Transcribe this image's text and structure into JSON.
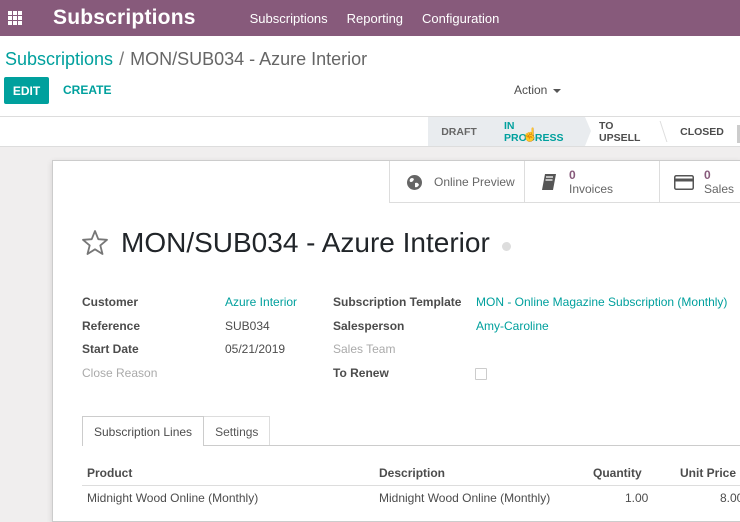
{
  "navbar": {
    "brand": "Subscriptions",
    "menu": [
      "Subscriptions",
      "Reporting",
      "Configuration"
    ]
  },
  "breadcrumb": {
    "parent": "Subscriptions",
    "separator": "/",
    "current": "MON/SUB034 - Azure Interior"
  },
  "toolbar": {
    "edit_label": "EDIT",
    "create_label": "CREATE",
    "action_label": "Action"
  },
  "statusbar": {
    "stages": [
      "DRAFT",
      "IN PROGRESS",
      "TO UPSELL",
      "CLOSED"
    ],
    "current_stage": "IN PROGRESS"
  },
  "smart_buttons": {
    "preview": {
      "label": "Online Preview",
      "icon": "globe-icon"
    },
    "invoices": {
      "count": "0",
      "label": "Invoices",
      "icon": "book-icon"
    },
    "sales": {
      "count": "0",
      "label": "Sales",
      "icon": "credit-card-icon"
    }
  },
  "record": {
    "title": "MON/SUB034 - Azure Interior",
    "favorite": false
  },
  "fields": {
    "customer_label": "Customer",
    "customer_value": "Azure Interior",
    "reference_label": "Reference",
    "reference_value": "SUB034",
    "start_date_label": "Start Date",
    "start_date_value": "05/21/2019",
    "close_reason_label": "Close Reason",
    "template_label": "Subscription Template",
    "template_value": "MON - Online Magazine Subscription (Monthly)",
    "salesperson_label": "Salesperson",
    "salesperson_value": "Amy-Caroline",
    "sales_team_label": "Sales Team",
    "to_renew_label": "To Renew",
    "to_renew_checked": false
  },
  "notebook": {
    "tabs": [
      "Subscription Lines",
      "Settings"
    ],
    "active_tab": "Subscription Lines"
  },
  "lines_table": {
    "headers": [
      "Product",
      "Description",
      "Quantity",
      "Unit Price"
    ],
    "rows": [
      [
        "Midnight Wood Online (Monthly)",
        "Midnight Wood Online (Monthly)",
        "1.00",
        "8.00"
      ]
    ]
  },
  "colors": {
    "navbar": "#875a7b",
    "accent": "#00a09d"
  }
}
